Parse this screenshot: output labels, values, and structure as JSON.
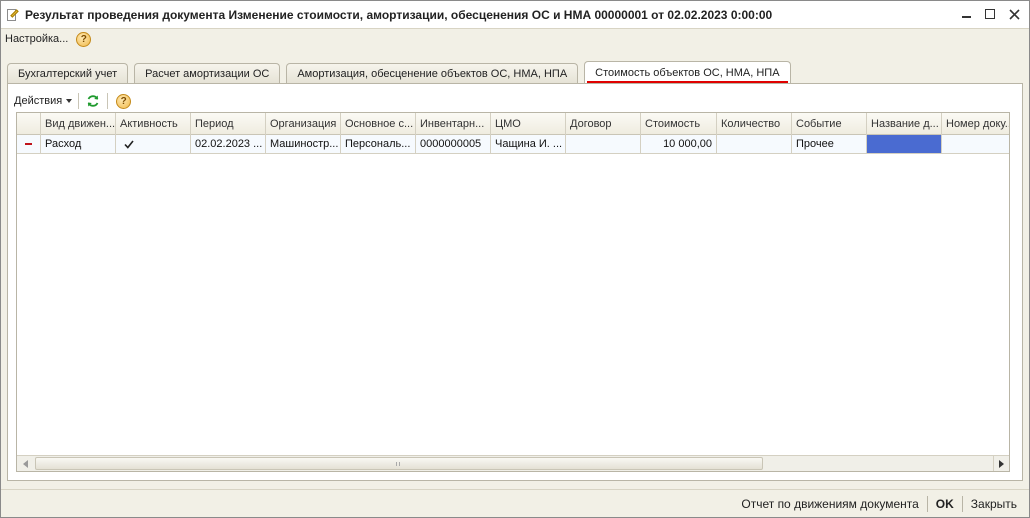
{
  "window": {
    "title": "Результат проведения документа Изменение стоимости, амортизации, обесценения ОС и НМА 00000001 от 02.02.2023 0:00:00"
  },
  "menu": {
    "settings_label": "Настройка...",
    "help_symbol": "?"
  },
  "tabs": [
    {
      "label": "Бухгалтерский учет",
      "active": false
    },
    {
      "label": "Расчет амортизации ОС",
      "active": false
    },
    {
      "label": "Амортизация, обесценение объектов ОС, НМА, НПА",
      "active": false
    },
    {
      "label": "Стоимость объектов ОС, НМА, НПА",
      "active": true
    }
  ],
  "toolbar": {
    "actions_label": "Действия",
    "help_symbol": "?"
  },
  "grid": {
    "columns": [
      "",
      "Вид движен...",
      "Активность",
      "Период",
      "Организация",
      "Основное с...",
      "Инвентарн...",
      "ЦМО",
      "Договор",
      "Стоимость",
      "Количество",
      "Событие",
      "Название д...",
      "Номер доку..."
    ],
    "rows": [
      {
        "movement_type": "Расход",
        "active": true,
        "period": "02.02.2023 ...",
        "organization": "Машиностр...",
        "asset": "Персональ...",
        "inventory": "0000000005",
        "cmo": "Чащина И. ...",
        "contract": "",
        "cost": "10 000,00",
        "quantity": "",
        "event": "Прочее",
        "doc_name": "",
        "doc_number": ""
      }
    ]
  },
  "footer": {
    "report_label": "Отчет по движениям документа",
    "ok_label": "OK",
    "close_label": "Закрыть"
  },
  "colors": {
    "accent_underline": "#e00000",
    "selected_cell": "#4a6bd1",
    "expense_marker": "#c0141b"
  },
  "icons": {
    "refresh": "refresh-icon",
    "help": "help-icon",
    "check": "check-icon"
  }
}
